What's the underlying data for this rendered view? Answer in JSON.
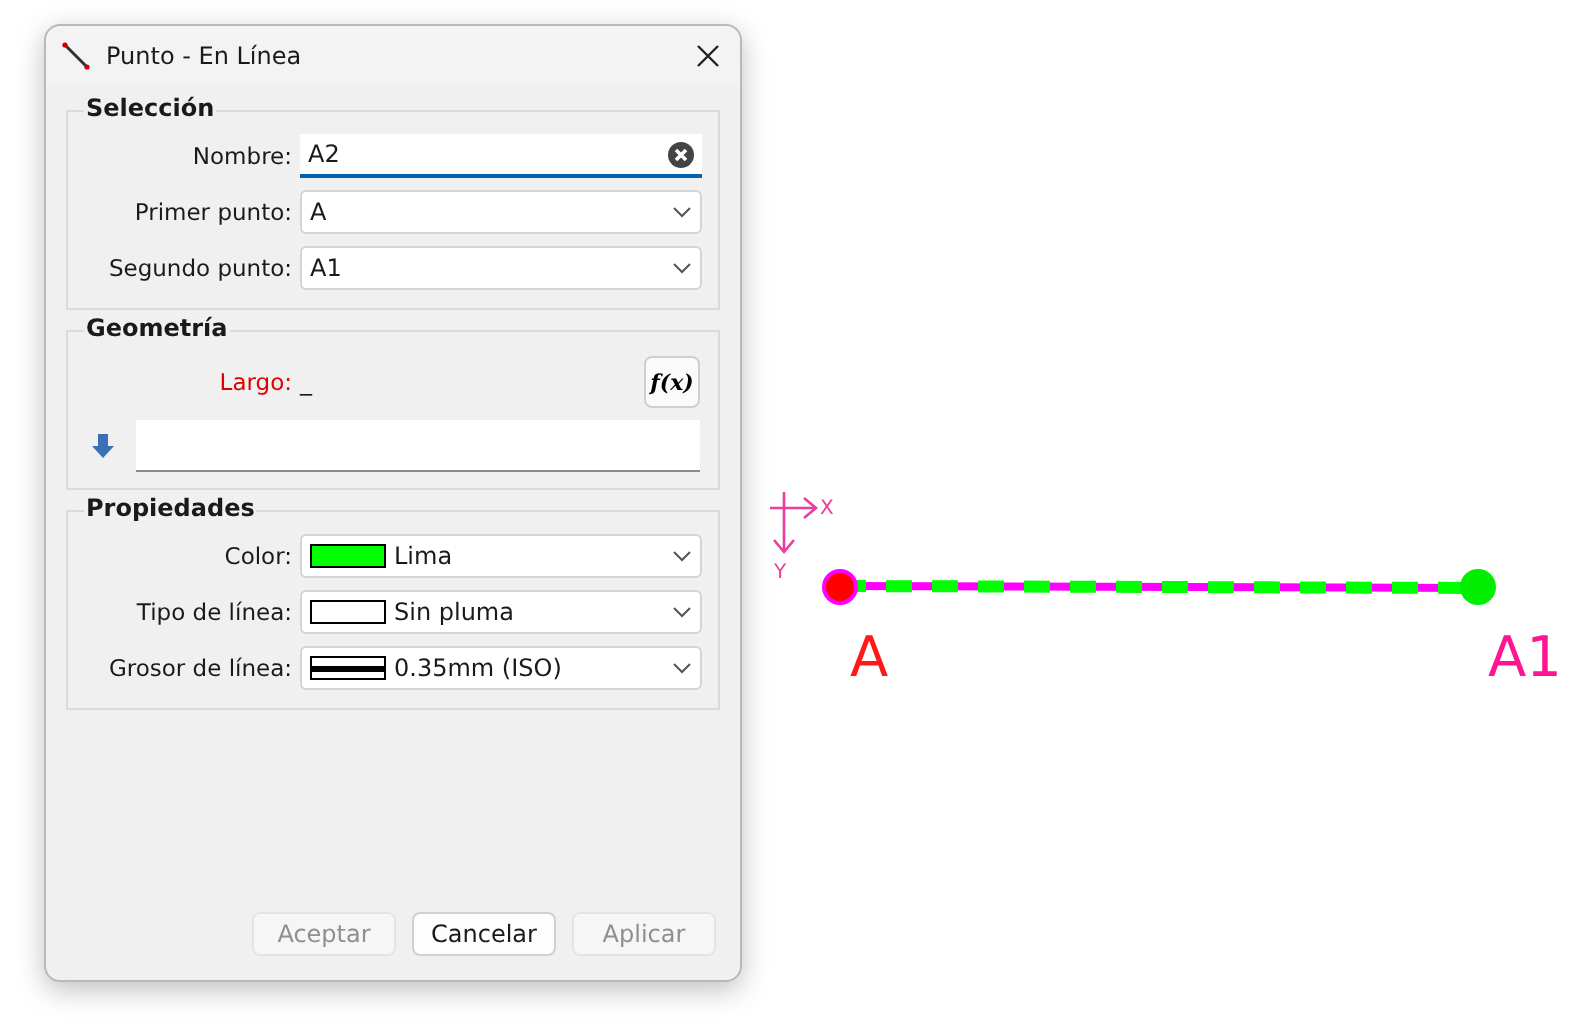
{
  "window": {
    "title": "Punto - En Línea"
  },
  "seleccion": {
    "title": "Selección",
    "fields": [
      {
        "kind": "text",
        "label": "Nombre:",
        "value": "A2",
        "focused": true
      },
      {
        "kind": "combo",
        "label": "Primer punto:",
        "value": "A"
      },
      {
        "kind": "combo",
        "label": "Segundo punto:",
        "value": "A1"
      }
    ]
  },
  "geometria": {
    "title": "Geometría",
    "label": "Largo:",
    "value": "_",
    "formula_button": "f(x)"
  },
  "propiedades": {
    "title": "Propiedades",
    "fields": [
      {
        "kind": "color",
        "label": "Color:",
        "value": "Lima",
        "color": "#00ff00"
      },
      {
        "kind": "pen",
        "label": "Tipo de línea:",
        "value": "Sin pluma"
      },
      {
        "kind": "width",
        "label": "Grosor de línea:",
        "value": "0.35mm (ISO)"
      }
    ]
  },
  "buttons": [
    {
      "label": "Aceptar",
      "disabled": true
    },
    {
      "label": "Cancelar",
      "disabled": false
    },
    {
      "label": "Aplicar",
      "disabled": true
    }
  ],
  "canvas": {
    "axis_x": "X",
    "axis_y": "Y",
    "points": [
      {
        "label": "A",
        "selected": true
      },
      {
        "label": "A1",
        "selected": false
      }
    ]
  }
}
